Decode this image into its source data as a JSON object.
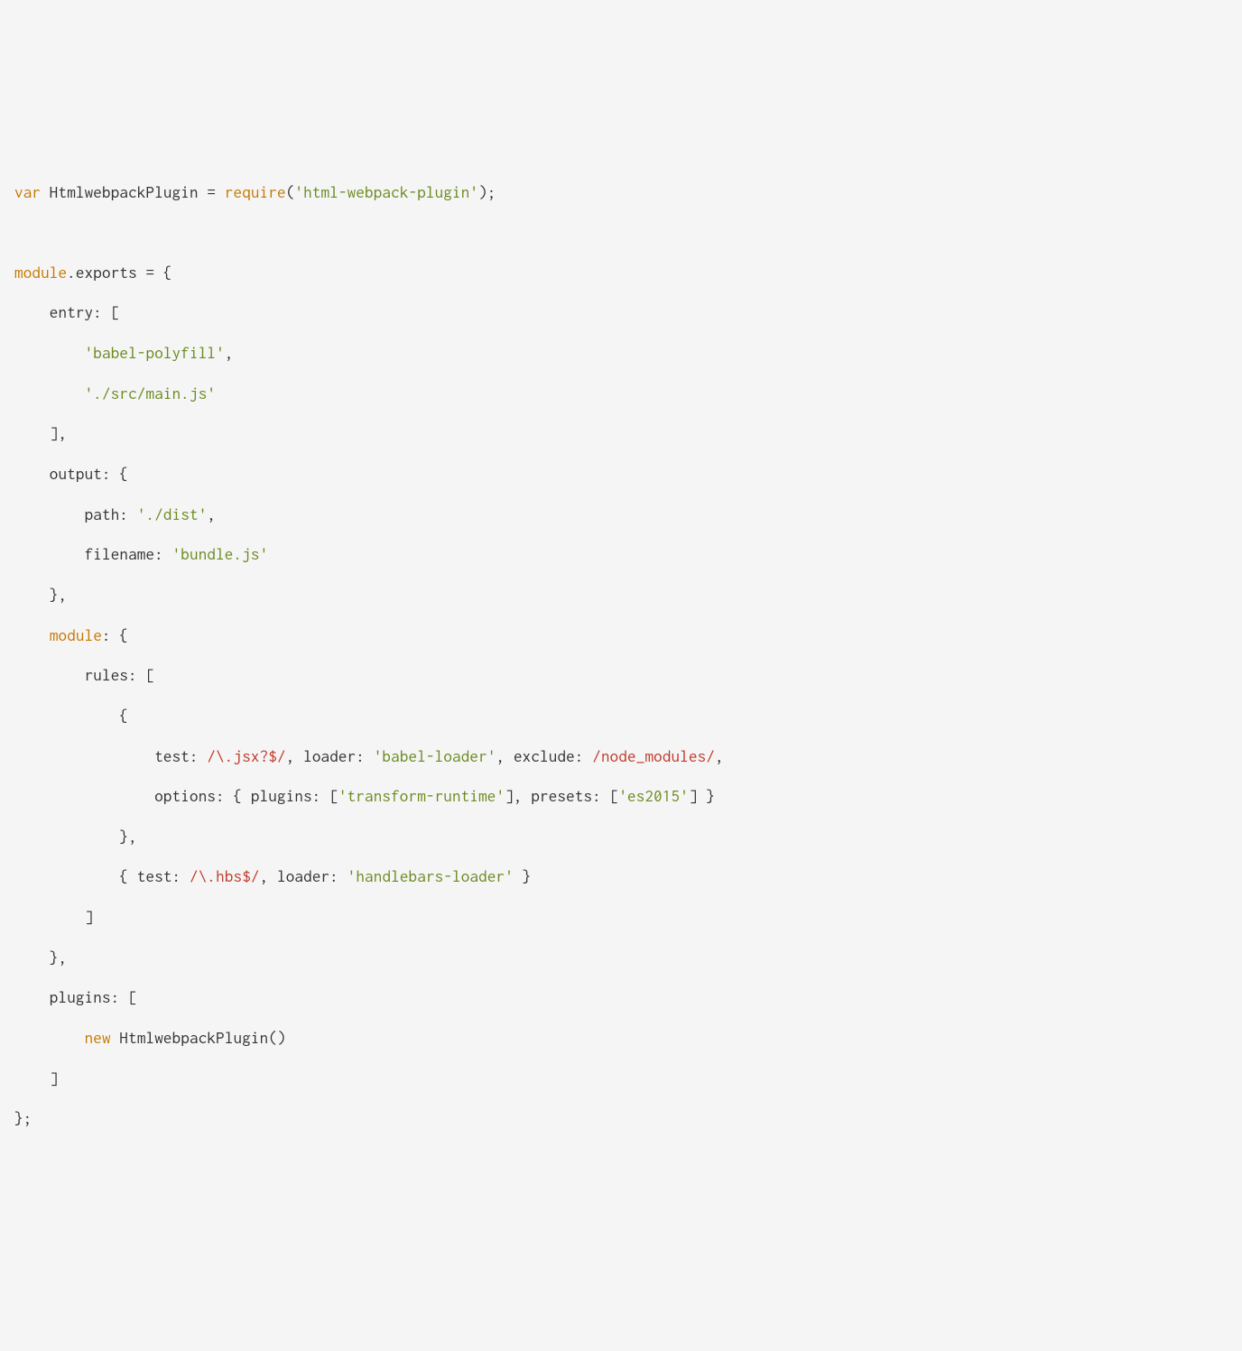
{
  "tokens": [
    {
      "t": "var",
      "c": "kw"
    },
    {
      "t": " HtmlwebpackPlugin = ",
      "c": "ident"
    },
    {
      "t": "require",
      "c": "kw"
    },
    {
      "t": "(",
      "c": "punct"
    },
    {
      "t": "'html-webpack-plugin'",
      "c": "str"
    },
    {
      "t": ");",
      "c": "punct"
    },
    {
      "br": 2
    },
    {
      "t": "module",
      "c": "kw"
    },
    {
      "t": ".exports = {",
      "c": "ident"
    },
    {
      "br": 1
    },
    {
      "t": "    entry: [",
      "c": "ident"
    },
    {
      "br": 1
    },
    {
      "t": "        ",
      "c": "ident"
    },
    {
      "t": "'babel-polyfill'",
      "c": "str"
    },
    {
      "t": ",",
      "c": "punct"
    },
    {
      "br": 1
    },
    {
      "t": "        ",
      "c": "ident"
    },
    {
      "t": "'./src/main.js'",
      "c": "str"
    },
    {
      "br": 1
    },
    {
      "t": "    ],",
      "c": "ident"
    },
    {
      "br": 1
    },
    {
      "t": "    output: {",
      "c": "ident"
    },
    {
      "br": 1
    },
    {
      "t": "        path: ",
      "c": "ident"
    },
    {
      "t": "'./dist'",
      "c": "str"
    },
    {
      "t": ",",
      "c": "punct"
    },
    {
      "br": 1
    },
    {
      "t": "        filename: ",
      "c": "ident"
    },
    {
      "t": "'bundle.js'",
      "c": "str"
    },
    {
      "br": 1
    },
    {
      "t": "    },",
      "c": "ident"
    },
    {
      "br": 1
    },
    {
      "t": "    ",
      "c": "ident"
    },
    {
      "t": "module",
      "c": "kw"
    },
    {
      "t": ": {",
      "c": "ident"
    },
    {
      "br": 1
    },
    {
      "t": "        rules: [",
      "c": "ident"
    },
    {
      "br": 1
    },
    {
      "t": "            {",
      "c": "ident"
    },
    {
      "br": 1
    },
    {
      "t": "                test: ",
      "c": "ident"
    },
    {
      "t": "/\\.jsx?$/",
      "c": "regex"
    },
    {
      "t": ", loader: ",
      "c": "ident"
    },
    {
      "t": "'babel-loader'",
      "c": "str"
    },
    {
      "t": ", exclude: ",
      "c": "ident"
    },
    {
      "t": "/node_modules/",
      "c": "regex"
    },
    {
      "t": ",",
      "c": "punct"
    },
    {
      "br": 1
    },
    {
      "t": "                options: { plugins: [",
      "c": "ident"
    },
    {
      "t": "'transform-runtime'",
      "c": "str"
    },
    {
      "t": "], presets: [",
      "c": "ident"
    },
    {
      "t": "'es2015'",
      "c": "str"
    },
    {
      "t": "] }",
      "c": "ident"
    },
    {
      "br": 1
    },
    {
      "t": "            },",
      "c": "ident"
    },
    {
      "br": 1
    },
    {
      "t": "            { test: ",
      "c": "ident"
    },
    {
      "t": "/\\.hbs$/",
      "c": "regex"
    },
    {
      "t": ", loader: ",
      "c": "ident"
    },
    {
      "t": "'handlebars-loader'",
      "c": "str"
    },
    {
      "t": " }",
      "c": "ident"
    },
    {
      "br": 1
    },
    {
      "t": "        ]",
      "c": "ident"
    },
    {
      "br": 1
    },
    {
      "t": "    },",
      "c": "ident"
    },
    {
      "br": 1
    },
    {
      "t": "    plugins: [",
      "c": "ident"
    },
    {
      "br": 1
    },
    {
      "t": "        ",
      "c": "ident"
    },
    {
      "t": "new",
      "c": "kw"
    },
    {
      "t": " HtmlwebpackPlugin()",
      "c": "ident"
    },
    {
      "br": 1
    },
    {
      "t": "    ]",
      "c": "ident"
    },
    {
      "br": 1
    },
    {
      "t": "};",
      "c": "ident"
    }
  ]
}
